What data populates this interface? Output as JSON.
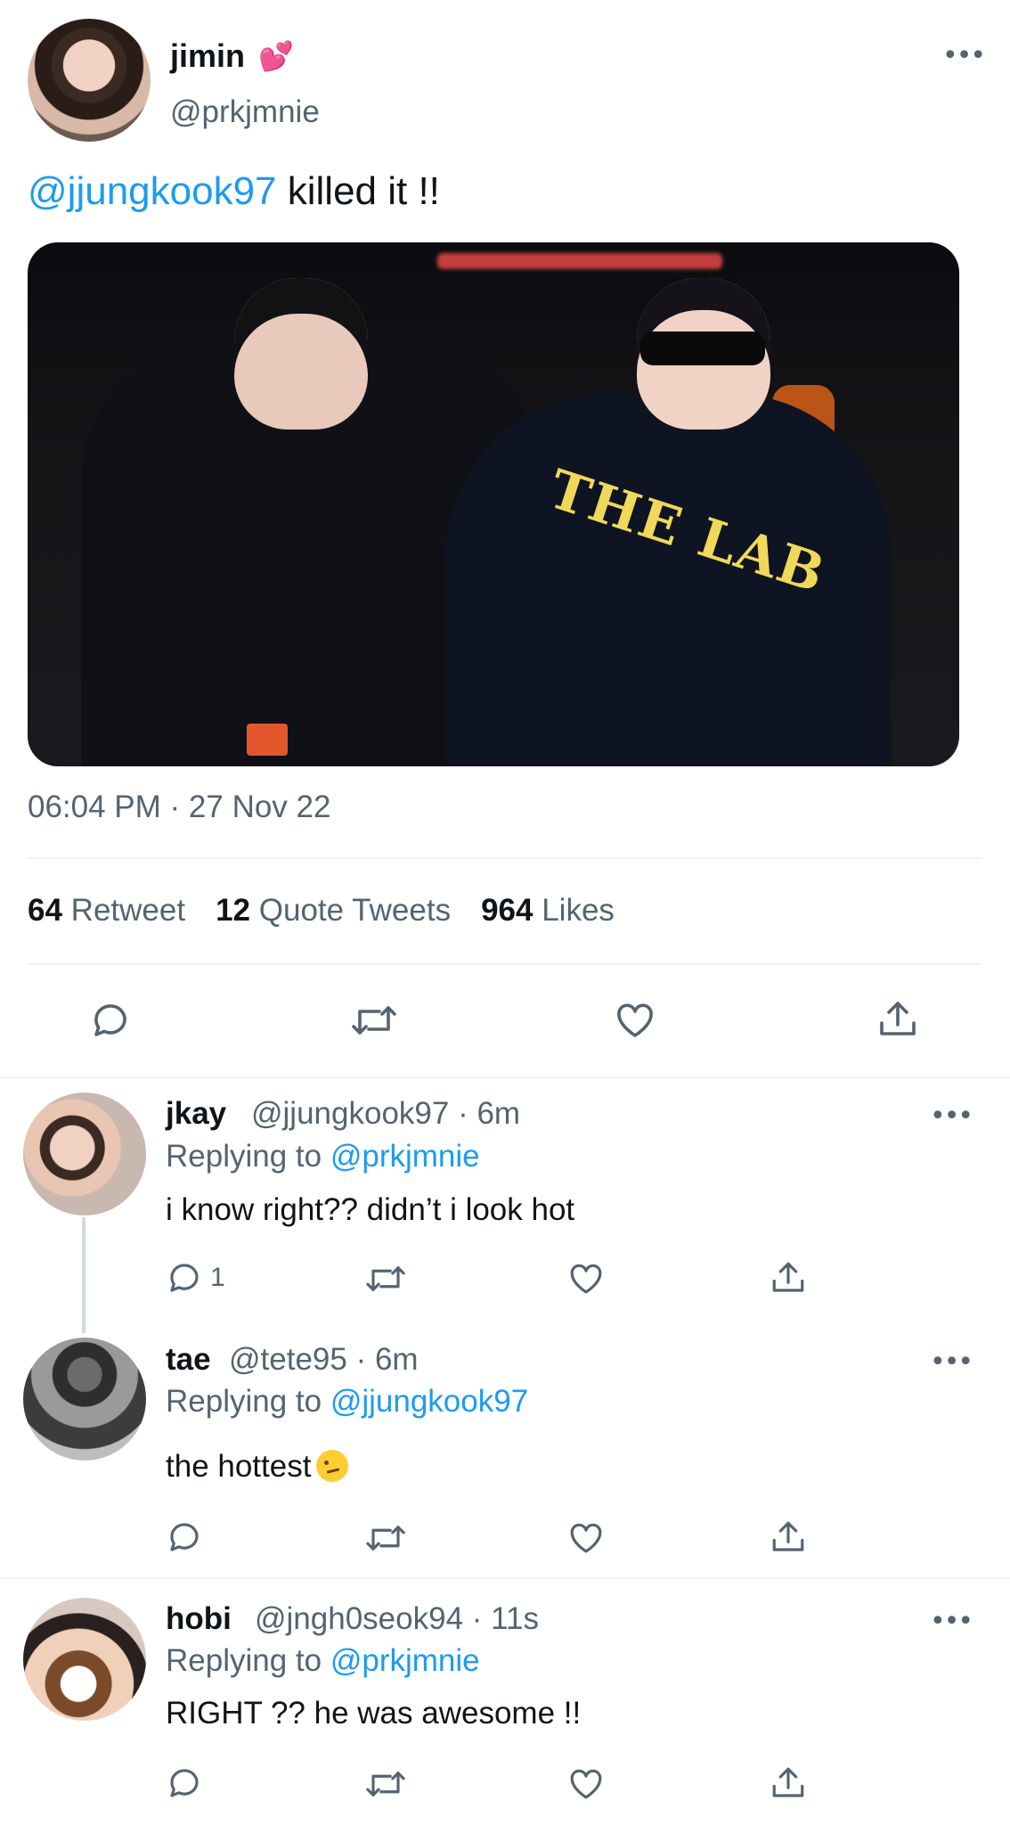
{
  "main_tweet": {
    "display_name": "jimin",
    "name_emoji": "💕",
    "handle": "@prkjmnie",
    "text_mention": "@jjungkook97",
    "text_body": " killed it !!",
    "photo_text": "THE LAB",
    "timestamp": "06:04 PM · 27 Nov 22",
    "stats": {
      "retweets_count": "64",
      "retweets_label": "Retweet",
      "quotes_count": "12",
      "quotes_label": "Quote Tweets",
      "likes_count": "964",
      "likes_label": "Likes"
    },
    "actions": [
      "reply-icon",
      "retweet-icon",
      "like-icon",
      "share-icon"
    ]
  },
  "replies": [
    {
      "name": "jkay",
      "meta": "@jjungkook97 · 6m",
      "replying_prefix": "Replying to ",
      "replying_to": "@prkjmnie",
      "text": "i know right?? didn’t i look hot",
      "reply_count": "1"
    },
    {
      "name": "tae",
      "meta": "@tete95 · 6m",
      "replying_prefix": "Replying to ",
      "replying_to": "@jjungkook97",
      "text": "the hottest",
      "emoji": "woozy-face-emoji",
      "reply_count": ""
    },
    {
      "name": "hobi",
      "meta": "@jngh0seok94 · 11s",
      "replying_prefix": "Replying to ",
      "replying_to": "@prkjmnie",
      "text": "RIGHT ?? he was awesome !!",
      "reply_count": ""
    }
  ],
  "colors": {
    "accent": "#1d9bf0",
    "secondary_text": "#536471",
    "primary_text": "#0f1419",
    "divider": "#eff3f4"
  }
}
